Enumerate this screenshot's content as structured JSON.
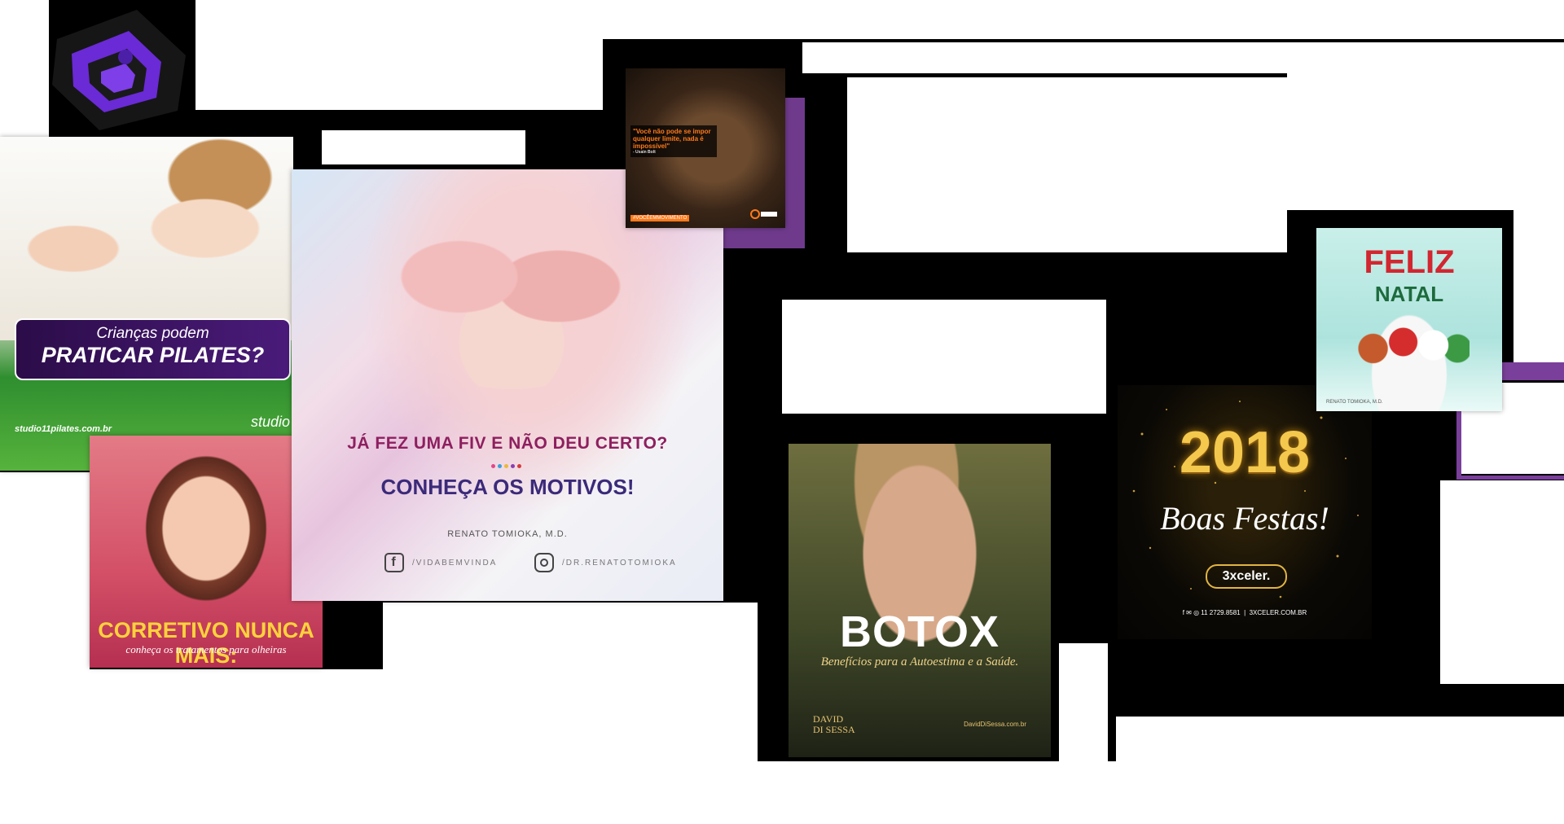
{
  "pilates": {
    "line1": "Crianças podem",
    "line2": "PRATICAR PILATES?",
    "site": "studio11pilates.com.br",
    "brand": "studio"
  },
  "corretivo": {
    "title": "CORRETIVO NUNCA MAIS:",
    "subtitle": "conheça os tratamentos para olheiras"
  },
  "fiv": {
    "question": "JÁ FEZ UMA FIV E NÃO DEU CERTO?",
    "headline": "CONHEÇA OS MOTIVOS!",
    "doctor": "RENATO TOMIOKA, M.D.",
    "facebook": "/VIDABEMVINDA",
    "instagram": "/DR.RENATOTOMIOKA",
    "dot_colors": [
      "#e0478a",
      "#3aa0d8",
      "#e9b93a",
      "#8a3fb1",
      "#d63a3a"
    ]
  },
  "bolt": {
    "quote": "\"Você não pode se impor qualquer limite, nada é impossível\"",
    "author": "- Usain Bolt",
    "hashtag": "#VOCÊEMMOVIMENTO"
  },
  "botox": {
    "title": "BOTOX",
    "subtitle": "Benefícios para a Autoestima e a Saúde.",
    "brand_line1": "DAVID",
    "brand_line2": "DI SESSA",
    "site": "DavidDiSessa.com.br"
  },
  "newyear": {
    "year": "2018",
    "greeting": "Boas Festas!",
    "brand": "3xceler.",
    "phone": "11 2729.8581",
    "site": "3XCELER.COM.BR"
  },
  "natal": {
    "line1": "FELIZ",
    "line2": "NATAL",
    "doctor": "RENATO TOMIOKA, M.D."
  },
  "colors": {
    "accent_purple": "#7b3fa0",
    "logo_purple": "#6a2ad6"
  }
}
